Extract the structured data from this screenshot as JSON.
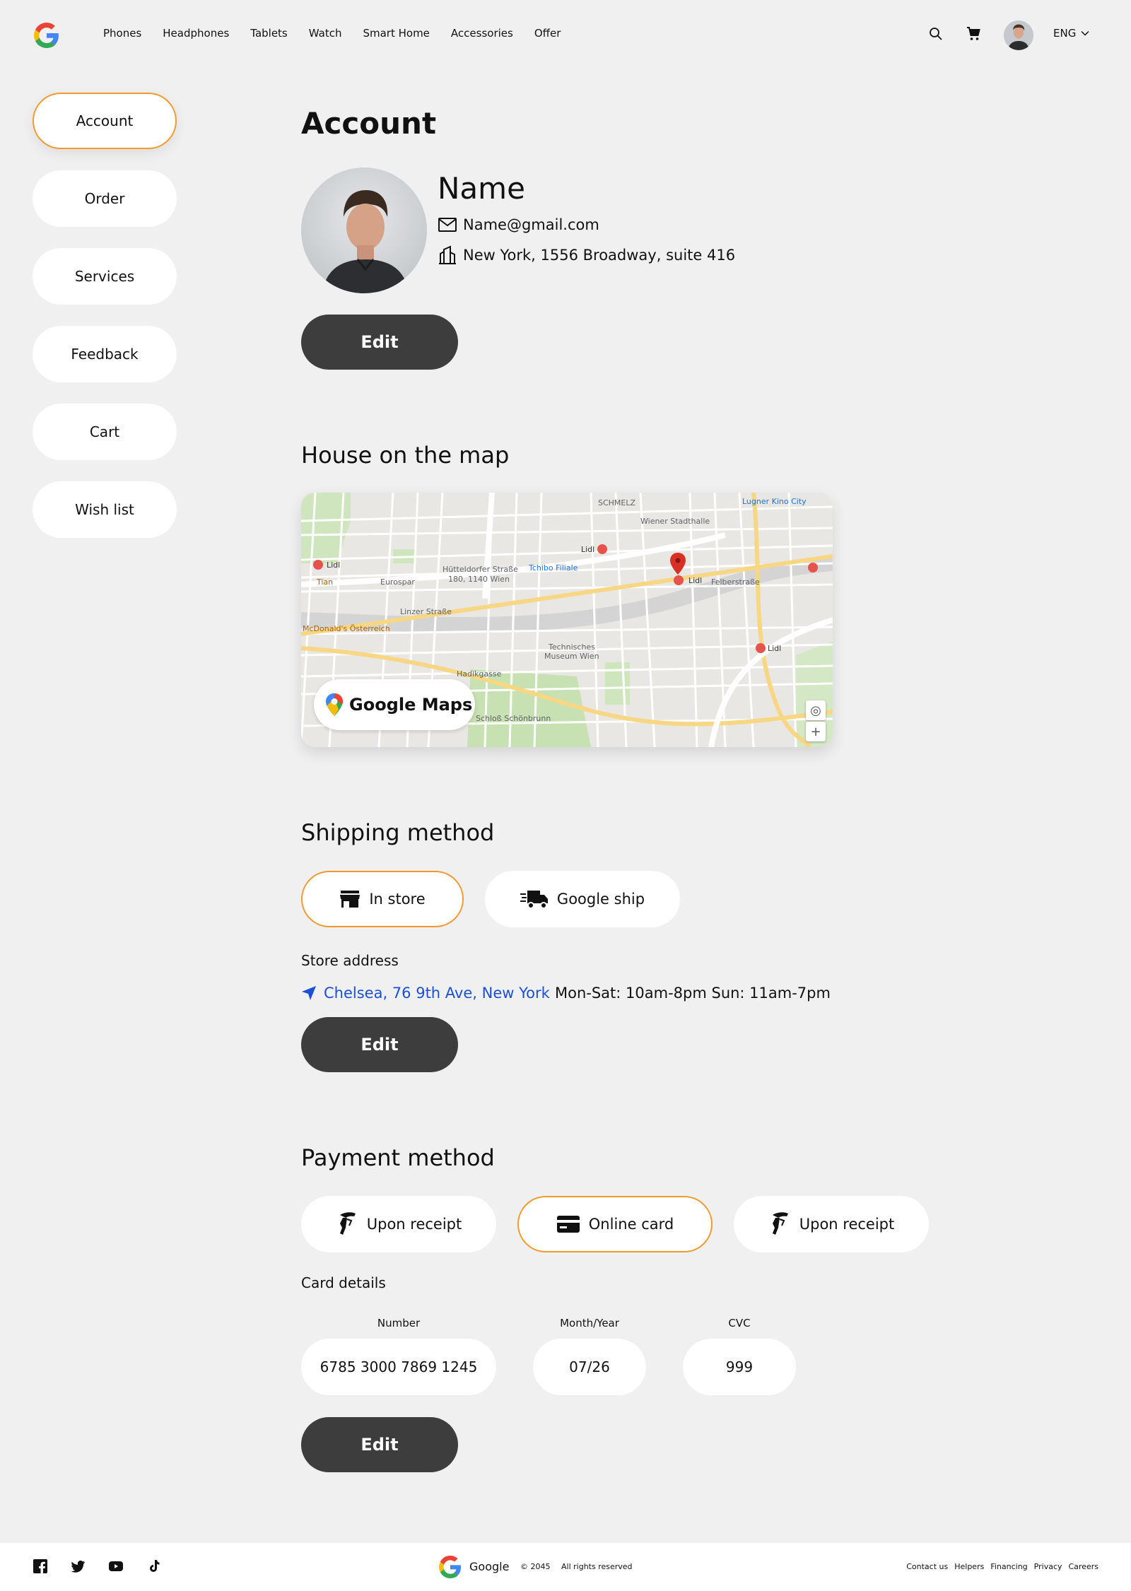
{
  "header": {
    "nav": [
      "Phones",
      "Headphones",
      "Tablets",
      "Watch",
      "Smart Home",
      "Accessories",
      "Offer"
    ],
    "language": "ENG"
  },
  "sidebar": {
    "items": [
      {
        "label": "Account",
        "active": true
      },
      {
        "label": "Order"
      },
      {
        "label": "Services"
      },
      {
        "label": "Feedback"
      },
      {
        "label": "Cart"
      },
      {
        "label": "Wish list"
      }
    ]
  },
  "account": {
    "title": "Account",
    "name": "Name",
    "email": "Name@gmail.com",
    "address": "New York, 1556 Broadway, suite 416",
    "edit_label": "Edit"
  },
  "map": {
    "title": "House on the map",
    "badge": "Google Maps",
    "labels": {
      "schmelz": "SCHMELZ",
      "lugner": "Lugner Kino City",
      "stadthalle": "Wiener Stadthalle",
      "lidl": "Lidl",
      "tchibo": "Tchibo Filiale",
      "eurospar": "Eurospar",
      "huttel": "Hütteldorfer Straße",
      "huttel_addr": "180, 1140 Wien",
      "tian": "Tian",
      "mcd": "McDonald's Österreich",
      "museum1": "Technisches",
      "museum2": "Museum Wien",
      "schloss": "Schloß Schönbrunn",
      "hadik": "Hadikgasse",
      "linzer": "Linzer Straße",
      "felber": "Felberstraße"
    }
  },
  "shipping": {
    "title": "Shipping method",
    "options": [
      "In store",
      "Google ship"
    ],
    "selected": "In store",
    "store_address_label": "Store address",
    "store_address": "Chelsea, 76 9th Ave, New York",
    "hours": "Mon-Sat: 10am-8pm Sun: 11am-7pm",
    "edit_label": "Edit"
  },
  "payment": {
    "title": "Payment method",
    "options": [
      "Upon receipt",
      "Online card",
      "Upon receipt"
    ],
    "selected": "Online card",
    "card_details_label": "Card details",
    "fields": {
      "number_label": "Number",
      "number": "6785 3000 7869 1245",
      "month_year_label": "Month/Year",
      "month_year": "07/26",
      "cvc_label": "CVC",
      "cvc": "999"
    },
    "edit_label": "Edit"
  },
  "footer": {
    "brand": "Google",
    "copyright": "© 2045",
    "rights": "All rights reserved",
    "links": [
      "Contact us",
      "Helpers",
      "Financing",
      "Privacy",
      "Careers"
    ]
  },
  "colors": {
    "accent": "#f29a2e",
    "dark_button": "#3d3d3d",
    "link": "#1a4fd6",
    "background": "#f0f0f0"
  }
}
